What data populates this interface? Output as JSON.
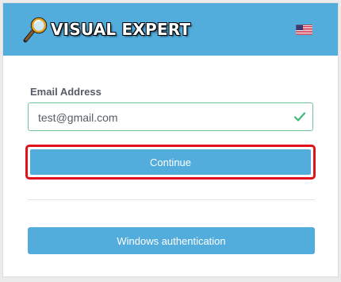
{
  "header": {
    "brand_text": "VISUAL EXPERT",
    "brand_icon": "magnifier-icon",
    "language_flag": "us-flag-icon",
    "background_color": "#52acdc"
  },
  "login": {
    "email_label": "Email Address",
    "email_value": "test@gmail.com",
    "email_valid_icon": "check-icon",
    "continue_label": "Continue",
    "windows_auth_label": "Windows authentication",
    "accent_color": "#52acdc",
    "highlight_color": "#e1121b",
    "valid_color": "#3db87a"
  }
}
